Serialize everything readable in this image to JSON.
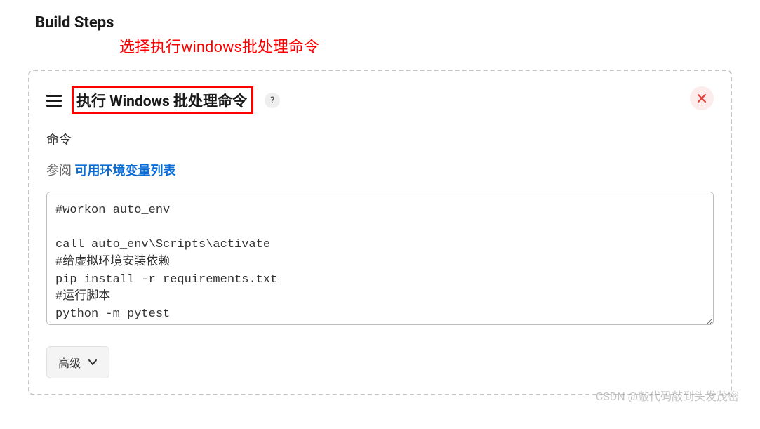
{
  "section": {
    "title": "Build Steps",
    "annotation": "选择执行windows批处理命令"
  },
  "step": {
    "title": "执行 Windows 批处理命令",
    "help_symbol": "?",
    "field_label": "命令",
    "see_also_prefix": "参阅",
    "see_also_link": "可用环境变量列表",
    "command_value": "#workon auto_env\n\ncall auto_env\\Scripts\\activate\n#给虚拟环境安装依赖\npip install -r requirements.txt\n#运行脚本\npython -m pytest",
    "advanced_label": "高级"
  },
  "watermark": "CSDN @敲代码敲到头发茂密"
}
